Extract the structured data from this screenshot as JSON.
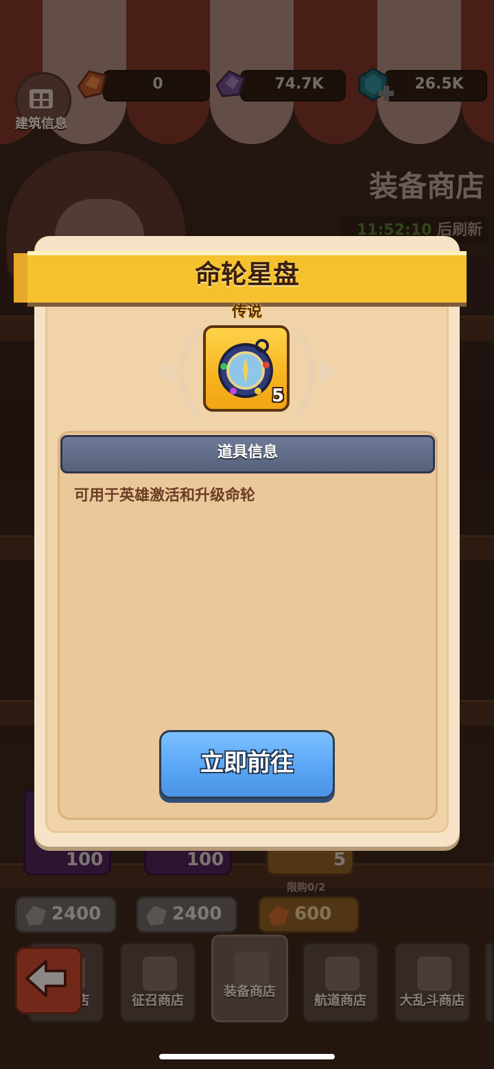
{
  "topbar": {
    "building_info_label": "建筑信息",
    "resources": [
      {
        "icon": "orange-crystal-icon",
        "value": "0"
      },
      {
        "icon": "purple-crystal-icon",
        "value": "74.7K"
      },
      {
        "icon": "blue-gem-plus-icon",
        "value": "26.5K"
      }
    ]
  },
  "shop": {
    "title": "装备商店",
    "refresh_time": "11:52:10",
    "refresh_suffix": " 后刷新",
    "item_counts": [
      "100",
      "100",
      "5"
    ],
    "limit_label": "限购0/2",
    "costs": [
      "2400",
      "2400",
      "600"
    ]
  },
  "bottom_tabs": [
    {
      "label": "店",
      "icon": "shop-icon"
    },
    {
      "label": "征召商店",
      "icon": "recruit-shop-icon"
    },
    {
      "label": "装备商店",
      "icon": "equipment-shop-icon",
      "active": true
    },
    {
      "label": "航道商店",
      "icon": "anchor-shop-icon"
    },
    {
      "label": "大乱斗商店",
      "icon": "brawl-shop-icon"
    }
  ],
  "modal": {
    "title": "命轮星盘",
    "rarity": "传说",
    "item_quantity": "5",
    "info_header": "道具信息",
    "description": "可用于英雄激活和升级命轮",
    "go_button": "立即前往"
  },
  "colors": {
    "banner": "#f5c12e",
    "go_button": "#5aa6f5",
    "info_header": "#5e6a84",
    "modal_bg": "#f6e3c7"
  }
}
